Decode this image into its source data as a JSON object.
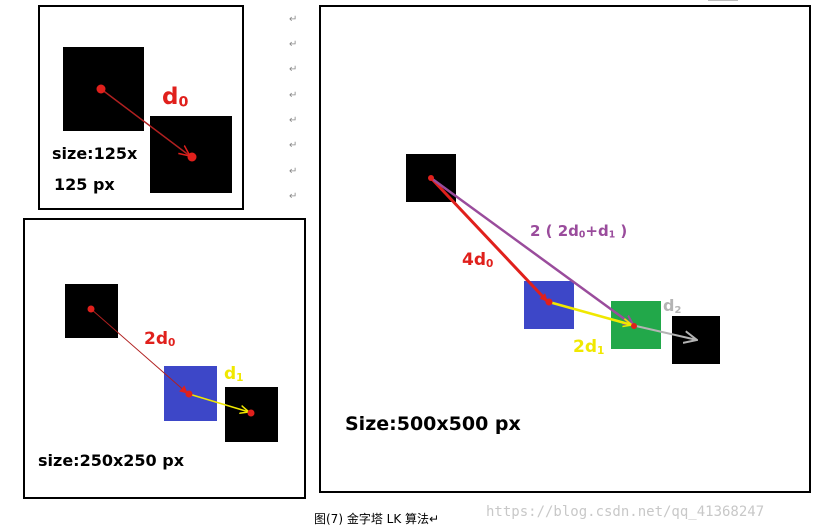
{
  "panels": {
    "small": {
      "label_d0": "d0",
      "size_line1": "size:125x",
      "size_line2": "125 px"
    },
    "medium": {
      "label_2d0": "2d0",
      "label_d1": "d1",
      "size_label": "size:250x250 px"
    },
    "large": {
      "label_4d0": "4d0",
      "label_sum": "2 ( 2d0+d1 )",
      "label_d2": "d2",
      "label_2d1": "2d1",
      "size_label": "Size:500x500  px"
    }
  },
  "caption": "图(7) 金字塔 LK 算法↵",
  "watermark": "https://blog.csdn.net/qq_41368247",
  "paragraph_mark": "↵",
  "colors": {
    "black": "#000000",
    "red": "#e0201c",
    "blue": "#3d47c8",
    "green": "#22a84a",
    "yellow": "#f0e800",
    "purple": "#9a4c9c",
    "gray": "#b4b4b4"
  }
}
